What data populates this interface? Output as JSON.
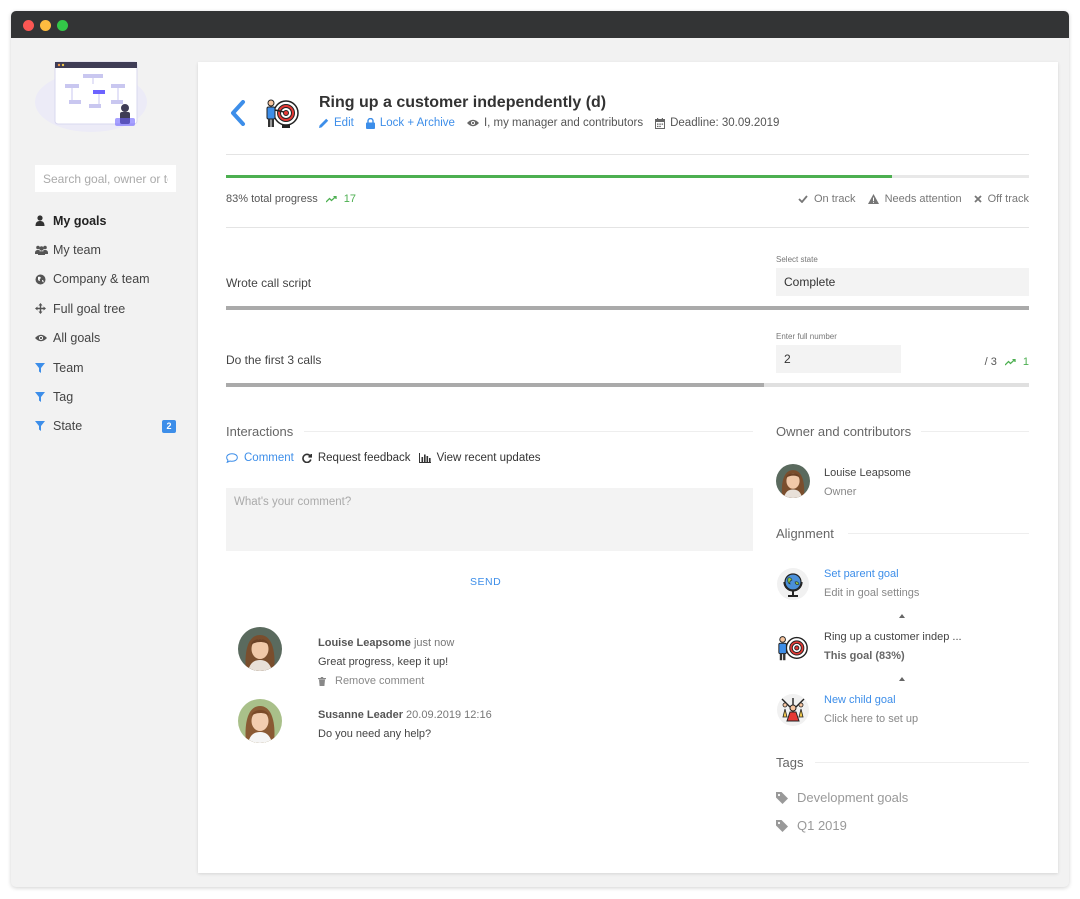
{
  "sidebar": {
    "search_placeholder": "Search goal, owner or te",
    "items": [
      {
        "label": "My goals",
        "icon": "user-icon"
      },
      {
        "label": "My team",
        "icon": "users-icon"
      },
      {
        "label": "Company & team",
        "icon": "globe-icon"
      },
      {
        "label": "Full goal tree",
        "icon": "move-icon"
      },
      {
        "label": "All goals",
        "icon": "eye-icon"
      },
      {
        "label": "Team",
        "icon": "filter-icon"
      },
      {
        "label": "Tag",
        "icon": "filter-icon"
      },
      {
        "label": "State",
        "icon": "filter-icon",
        "badge": "2"
      }
    ]
  },
  "goal": {
    "title": "Ring up a customer independently (d)",
    "edit": "Edit",
    "lock": "Lock + Archive",
    "visibility": "I, my manager and contributors",
    "deadline": "Deadline: 30.09.2019"
  },
  "progress": {
    "value_percent": 83,
    "label": "83% total progress",
    "delta": "17",
    "legend": {
      "on_track": "On track",
      "needs_attention": "Needs attention",
      "off_track": "Off track"
    }
  },
  "key_results": [
    {
      "label": "Wrote call script",
      "field_label": "Select state",
      "value": "Complete",
      "progress_percent": 100
    },
    {
      "label": "Do the first 3 calls",
      "field_label": "Enter full number",
      "value": "2",
      "of": "/ 3",
      "delta": "1",
      "progress_percent": 67
    }
  ],
  "interactions": {
    "title": "Interactions",
    "tabs": {
      "comment": "Comment",
      "request": "Request feedback",
      "updates": "View recent updates"
    },
    "placeholder": "What's your comment?",
    "send": "SEND",
    "comments": [
      {
        "name": "Louise Leapsome",
        "time": "just now",
        "text": "Great progress, keep it up!",
        "remove": "Remove comment"
      },
      {
        "name": "Susanne Leader",
        "time": "20.09.2019 12:16",
        "text": "Do you need any help?"
      }
    ]
  },
  "owners": {
    "title": "Owner and contributors",
    "name": "Louise Leapsome",
    "role": "Owner"
  },
  "alignment": {
    "title": "Alignment",
    "parent": {
      "link": "Set parent goal",
      "sub": "Edit in goal settings"
    },
    "current": {
      "name": "Ring up a customer indep ...",
      "sub": "This goal (83%)"
    },
    "child": {
      "link": "New child goal",
      "sub": "Click here to set up"
    }
  },
  "tags": {
    "title": "Tags",
    "items": [
      "Development goals",
      "Q1 2019"
    ]
  },
  "colors": {
    "accent": "#3d8ee9",
    "progress": "#4caf50"
  }
}
